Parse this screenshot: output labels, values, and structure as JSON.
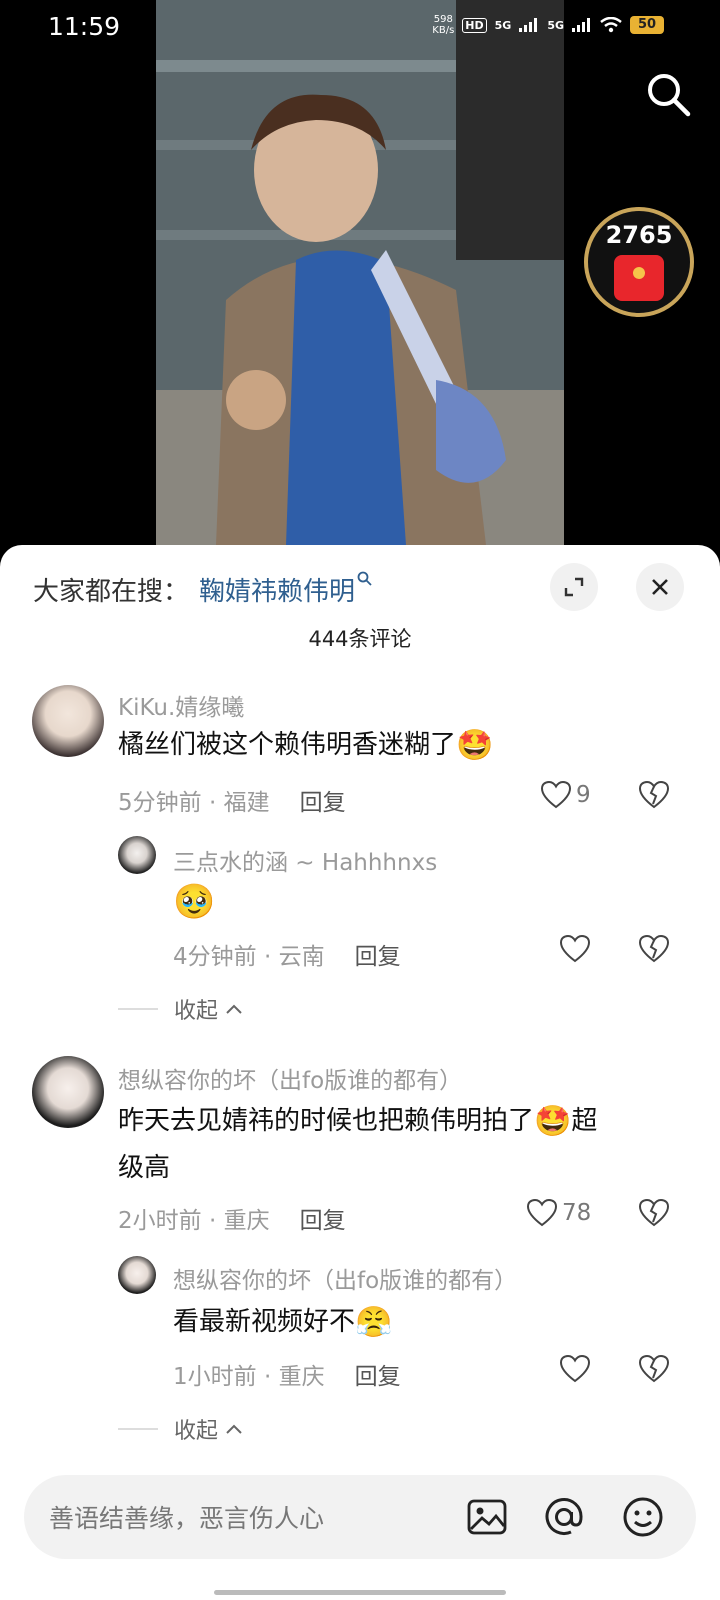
{
  "status": {
    "time": "11:59",
    "net_speed": "598\nKB/s",
    "hd": "HD",
    "signal1": "5G",
    "signal2": "5G",
    "battery": "50"
  },
  "video": {
    "search_icon": "search-icon",
    "redpack_count": "2765",
    "redpack_icon": "red-envelope-icon"
  },
  "sheet": {
    "search_prefix": "大家都在搜：",
    "search_keyword": "鞠婧祎赖伟明",
    "comment_count": "444条评论",
    "comments": [
      {
        "user": "KiKu.婧缘曦",
        "text": "橘丝们被这个赖伟明香迷糊了",
        "emoji": "🤩",
        "time": "5分钟前",
        "loc": "福建",
        "reply": "回复",
        "likes": "9",
        "replies": [
          {
            "user": "三点水的涵 ~ Hahhhnxs",
            "emoji": "🥹",
            "time": "4分钟前",
            "loc": "云南",
            "reply": "回复",
            "likes": ""
          }
        ],
        "collapse": "收起"
      },
      {
        "user": "想纵容你的坏（出fo版谁的都有）",
        "text_a": "昨天去见婧祎的时候也把赖伟明拍了",
        "emoji": "🤩",
        "text_b": "超",
        "text_c": "级高",
        "time": "2小时前",
        "loc": "重庆",
        "reply": "回复",
        "likes": "78",
        "replies": [
          {
            "user": "想纵容你的坏（出fo版谁的都有）",
            "text": "看最新视频好不",
            "emoji": "😤",
            "time": "1小时前",
            "loc": "重庆",
            "reply": "回复",
            "likes": ""
          }
        ],
        "collapse": "收起"
      }
    ]
  },
  "input": {
    "placeholder": "善语结善缘，恶言伤人心"
  },
  "colors": {
    "keyword": "#2f5f8f",
    "redpack": "#e8262c",
    "ring": "#c9a55a"
  }
}
